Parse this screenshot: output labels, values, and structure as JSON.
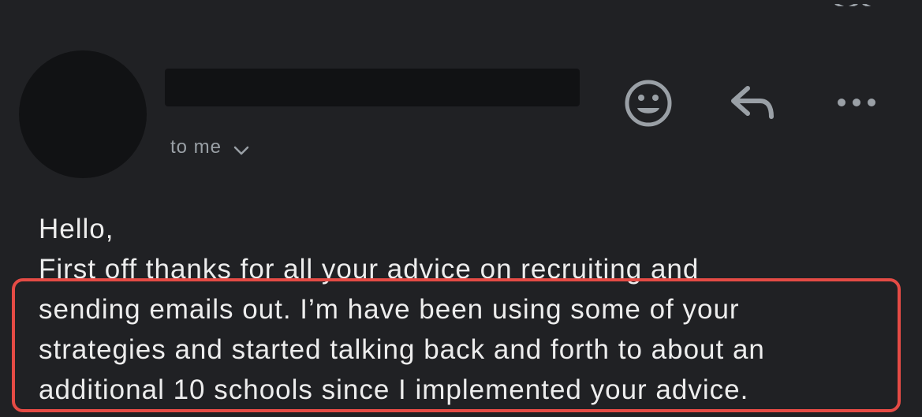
{
  "header": {
    "recipient_label": "to me",
    "icons": {
      "avatar": "avatar",
      "expand_recipients": "chevron-down-icon",
      "reaction": "emoji-icon",
      "reply": "reply-icon",
      "more": "more-options-icon"
    },
    "colors": {
      "background": "#202124",
      "avatar_fill": "#111214",
      "redaction_fill": "#111214",
      "icon_gray": "#9aa0a6",
      "highlight_red": "#e54b45"
    }
  },
  "message": {
    "lines": [
      "Hello,",
      "First off thanks for all your advice on recruiting and",
      "sending emails out. I’m have been using some of your",
      "strategies and started talking back and forth to about an",
      "additional 10 schools since I implemented your advice."
    ]
  }
}
